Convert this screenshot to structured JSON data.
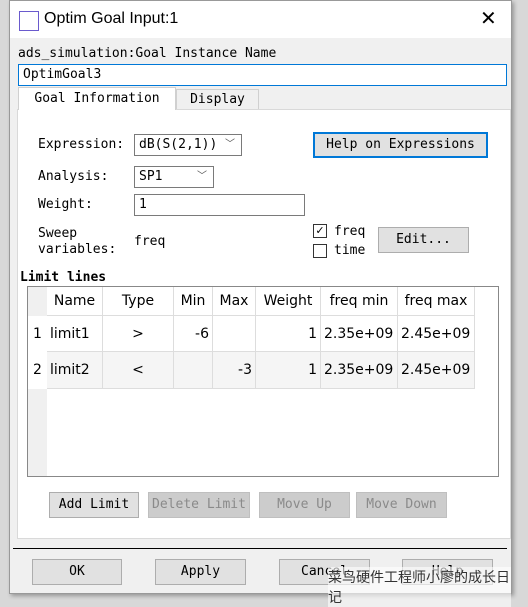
{
  "window": {
    "title": "Optim Goal Input:1",
    "close_icon": "close-icon"
  },
  "instance": {
    "label": "ads_simulation:Goal Instance Name",
    "value": "OptimGoal3"
  },
  "tabs": [
    {
      "label": "Goal Information",
      "active": true
    },
    {
      "label": "Display",
      "active": false
    }
  ],
  "form": {
    "expression_label": "Expression:",
    "expression_value": "dB(S(2,1))",
    "help_button": "Help on Expressions",
    "analysis_label": "Analysis:",
    "analysis_value": "SP1",
    "weight_label": "Weight:",
    "weight_value": "1",
    "sweep_label_1": "Sweep",
    "sweep_label_2": "variables:",
    "sweep_value": "freq",
    "checkboxes": [
      {
        "label": "freq",
        "checked": true
      },
      {
        "label": "time",
        "checked": false
      }
    ],
    "edit_button": "Edit..."
  },
  "limit_lines": {
    "title": "Limit lines",
    "columns": [
      "Name",
      "Type",
      "Min",
      "Max",
      "Weight",
      "freq min",
      "freq max"
    ],
    "rows": [
      {
        "num": "1",
        "cells": [
          "limit1",
          ">",
          "-6",
          "",
          "1",
          "2.35e+09",
          "2.45e+09"
        ]
      },
      {
        "num": "2",
        "cells": [
          "limit2",
          "<",
          "",
          "-3",
          "1",
          "2.35e+09",
          "2.45e+09"
        ]
      }
    ],
    "buttons": [
      {
        "label": "Add Limit",
        "enabled": true
      },
      {
        "label": "Delete Limit",
        "enabled": false
      },
      {
        "label": "Move Up",
        "enabled": false
      },
      {
        "label": "Move Down",
        "enabled": false
      }
    ]
  },
  "footer": {
    "ok": "OK",
    "apply": "Apply",
    "cancel": "Cancel",
    "help": "Help"
  },
  "watermark": "菜鸟硬件工程师小廖的成长日记",
  "colors": {
    "focus": "#0078d7",
    "panel": "#f0f0f0"
  }
}
